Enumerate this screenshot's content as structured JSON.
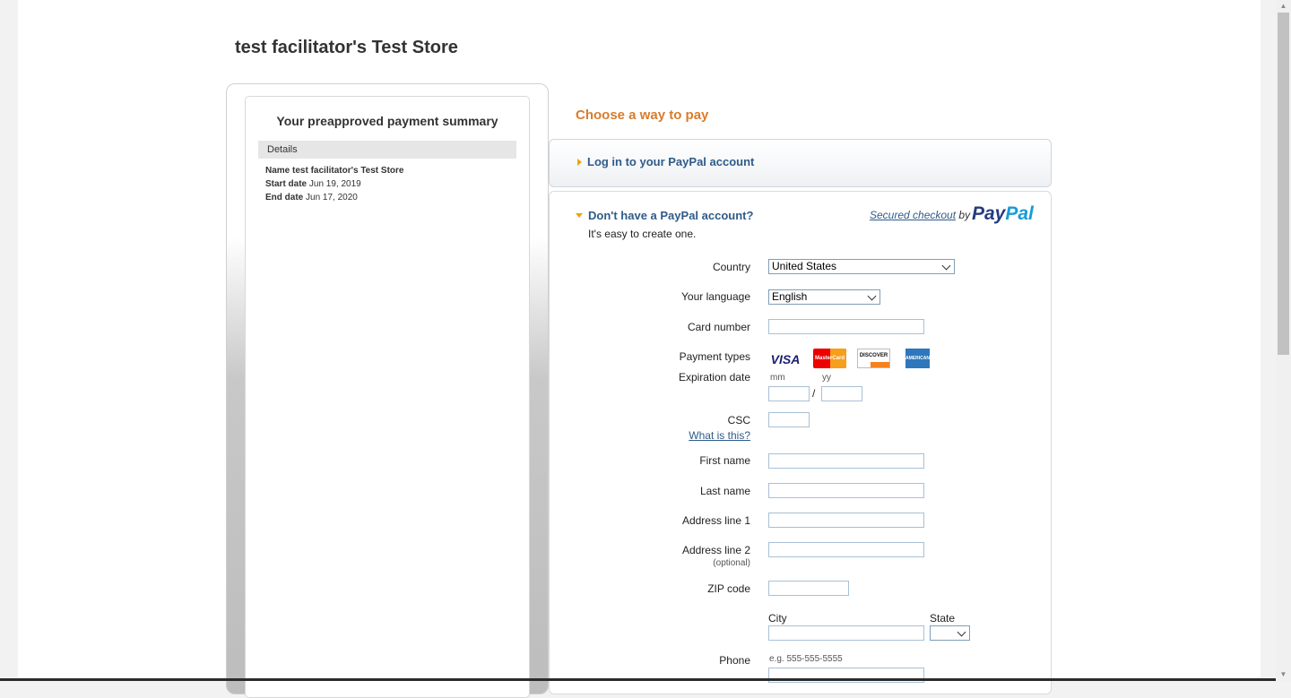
{
  "store": {
    "title": "test facilitator's Test Store"
  },
  "summary": {
    "title": "Your preapproved payment summary",
    "details_label": "Details",
    "rows": [
      {
        "label": "Name",
        "value": "test facilitator's Test Store"
      },
      {
        "label": "Start date",
        "value": "Jun 19, 2019"
      },
      {
        "label": "End date",
        "value": "Jun 17, 2020"
      }
    ]
  },
  "choose": {
    "title": "Choose a way to pay"
  },
  "login": {
    "label": "Log in to your PayPal account"
  },
  "signup": {
    "title": "Don't have a PayPal account?",
    "subtitle": "It's easy to create one.",
    "secured_link": "Secured checkout",
    "secured_by": " by ",
    "logo_a": "Pay",
    "logo_b": "Pal"
  },
  "form": {
    "country_label": "Country",
    "country_value": "United States",
    "language_label": "Your language",
    "language_value": "English",
    "card_number_label": "Card number",
    "payment_types_label": "Payment types",
    "cards": [
      "VISA",
      "MasterCard",
      "DISCOVER",
      "AMERICAN EXPRESS"
    ],
    "expiration_label": "Expiration date",
    "mm_hint": "mm",
    "yy_hint": "yy",
    "slash": "/",
    "csc_label": "CSC",
    "csc_help": "What is this?",
    "first_name_label": "First name",
    "last_name_label": "Last name",
    "address1_label": "Address line 1",
    "address2_label": "Address line 2",
    "optional": "(optional)",
    "zip_label": "ZIP code",
    "city_label": "City",
    "state_label": "State",
    "phone_label": "Phone",
    "phone_hint": "e.g. 555-555-5555"
  },
  "colors": {
    "accent_orange": "#d97c2b",
    "link_blue": "#2f5b89",
    "paypal_dark": "#253b80",
    "paypal_light": "#179bd7"
  }
}
